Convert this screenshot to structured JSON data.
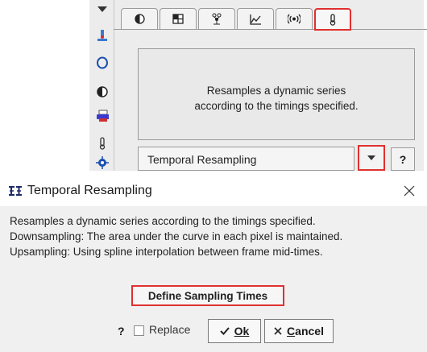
{
  "top_panel": {
    "toolbar_icons": [
      "scroll-up-arrow-icon",
      "microscope-icon",
      "ellipse-roi-icon",
      "contrast-icon",
      "printer-icon",
      "thermometer-icon",
      "crosshair-icon"
    ],
    "tabs": [
      "contrast-tab-icon",
      "grid-tab-icon",
      "molecule-tab-icon",
      "chart-tab-icon",
      "signal-tab-icon",
      "thermometer-tab-icon"
    ],
    "active_tab_index": 5,
    "description_lines": [
      "Resamples a dynamic series",
      "according to the timings specified."
    ],
    "dropdown_value": "Temporal Resampling",
    "help_label": "?"
  },
  "dialog": {
    "title": "Temporal Resampling",
    "body_lines": [
      "Resamples a dynamic series according to the timings specified.",
      "Downsampling: The area under the curve in each pixel is maintained.",
      "Upsampling: Using spline interpolation between frame mid-times."
    ],
    "define_button_label": "Define Sampling Times",
    "help_label": "?",
    "replace_label": "Replace",
    "replace_checked": false,
    "ok_label": "Ok",
    "cancel_label": "Cancel"
  },
  "colors": {
    "highlight": "#e03030",
    "panel_bg": "#ececec",
    "dialog_bg": "#f0f0f0"
  }
}
